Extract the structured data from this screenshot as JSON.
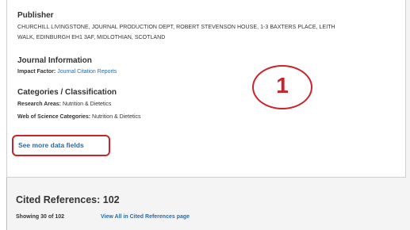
{
  "publisher": {
    "heading": "Publisher",
    "address_line1": "CHURCHILL LIVINGSTONE, JOURNAL PRODUCTION DEPT, ROBERT STEVENSON HOUSE, 1-3 BAXTERS PLACE, LEITH",
    "address_line2": "WALK, EDINBURGH EH1 3AF, MIDLOTHIAN, SCOTLAND"
  },
  "journal_information": {
    "heading": "Journal Information",
    "impact_factor_label": "Impact Factor:",
    "impact_factor_link": "Journal Citation Reports"
  },
  "categories": {
    "heading": "Categories / Classification",
    "research_areas_label": "Research Areas:",
    "research_areas_value": "Nutrition & Dietetics",
    "wos_categories_label": "Web of Science Categories:",
    "wos_categories_value": "Nutrition & Dietetics"
  },
  "see_more_label": "See more data fields",
  "annotation_number": "1",
  "annotation_color": "#c8242b",
  "link_color": "#2d6aa3",
  "cited_references": {
    "title": "Cited References: 102",
    "showing": "Showing 30 of 102",
    "view_all": "View All in Cited References page"
  }
}
